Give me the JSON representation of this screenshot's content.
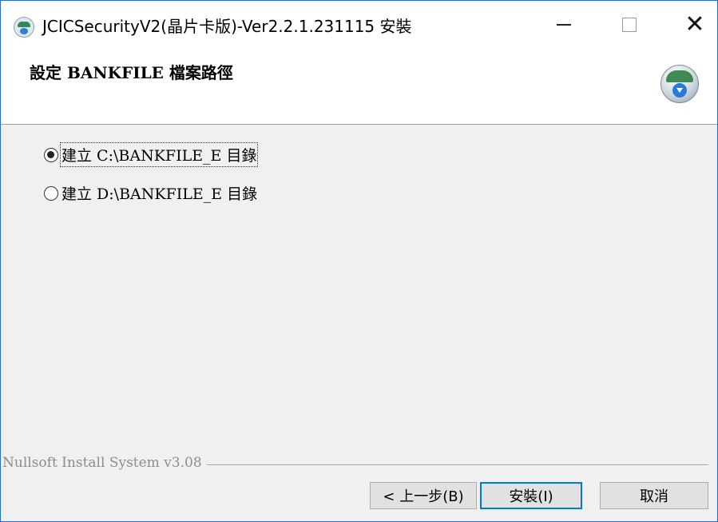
{
  "window": {
    "title": "JCICSecurityV2(晶片卡版)-Ver2.2.1.231115 安裝",
    "controls": {
      "minimize": "minimize-icon",
      "maximize": "maximize-icon",
      "close": "close-icon"
    }
  },
  "header": {
    "title": "設定 BANKFILE 檔案路徑",
    "icon": "installer-icon"
  },
  "options": [
    {
      "label": "建立 C:\\BANKFILE_E 目錄",
      "selected": true
    },
    {
      "label": "建立 D:\\BANKFILE_E 目錄",
      "selected": false
    }
  ],
  "footer": {
    "brand": "Nullsoft Install System v3.08"
  },
  "buttons": {
    "back": "< 上一步(B)",
    "install": "安裝(I)",
    "cancel": "取消"
  },
  "colors": {
    "accent": "#0078d7",
    "window_border": "#1e6fd0",
    "background": "#f0f0f0"
  }
}
